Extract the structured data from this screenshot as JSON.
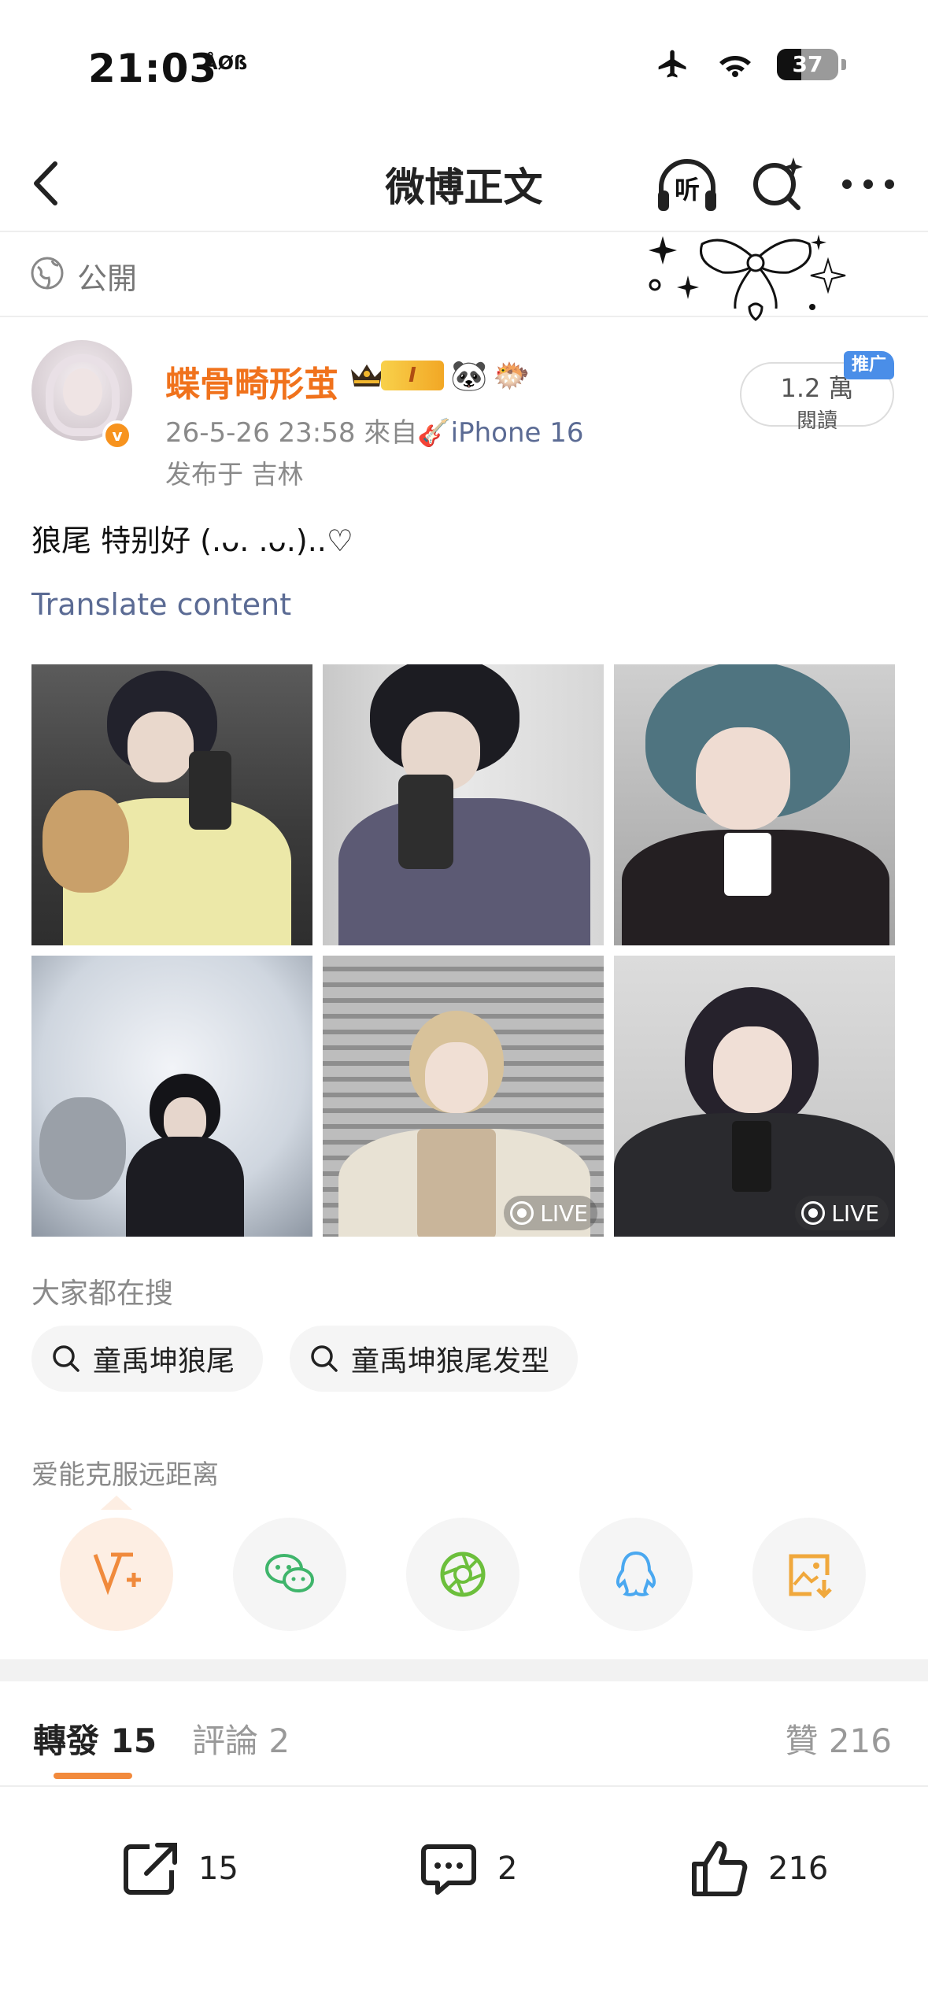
{
  "status_bar": {
    "time": "21:03",
    "time_badge": "ÅØß",
    "battery": "37"
  },
  "nav": {
    "title": "微博正文",
    "listen_label": "听"
  },
  "visibility": {
    "label": "公開"
  },
  "user": {
    "name": "蝶骨畸形茧",
    "vip_level": "I",
    "meta_prefix": "26-5-26 23:58  來自🎸",
    "device": "iPhone 16",
    "location": "发布于 吉林",
    "reads_count": "1.2 萬",
    "reads_label": "閱讀",
    "promo_label": "推广"
  },
  "post": {
    "text": "狼尾 特别好 (.ᴗ. .ᴗ.)..♡",
    "translate": "Translate content",
    "live_label": "LIVE"
  },
  "searches": {
    "title": "大家都在搜",
    "chips": [
      "童禹坤狼尾",
      "童禹坤狼尾发型"
    ]
  },
  "share": {
    "title": "爱能克服远距离",
    "targets": [
      "weibo-share",
      "wechat",
      "moments",
      "qq",
      "save-image"
    ]
  },
  "tabs": {
    "repost": "轉發 15",
    "comments": "評論 2",
    "likes": "贊 216"
  },
  "actions": {
    "repost_count": "15",
    "comment_count": "2",
    "like_count": "216"
  },
  "colors": {
    "accent_orange": "#f0721c",
    "link_blue": "#5b6b94",
    "tab_underline": "#f28a3c"
  }
}
